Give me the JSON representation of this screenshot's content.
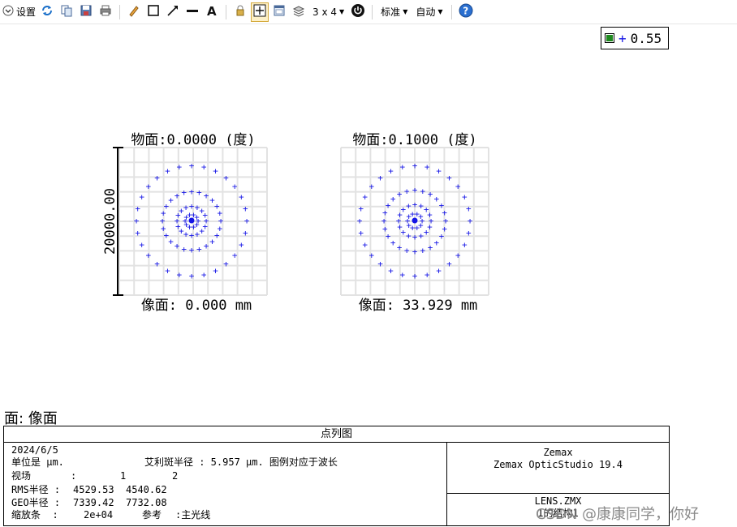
{
  "toolbar": {
    "settings_label": "设置",
    "layout_label": "3 x 4",
    "standard_label": "标准",
    "auto_label": "自动"
  },
  "legend": {
    "value": "0.55",
    "marker": "+"
  },
  "colors": {
    "spot": "#1515e6",
    "grid": "#e2e2e2",
    "scale": "#000000"
  },
  "plots": [
    {
      "title": "物面:0.0000 (度)",
      "image_label": "像面: 0.000 mm"
    },
    {
      "title": "物面:0.1000 (度)",
      "image_label": "像面: 33.929 mm"
    }
  ],
  "scale_bar": {
    "value": "20000.00"
  },
  "plane_label": "面: 像面",
  "footer": {
    "title": "点列图",
    "date": "2024/6/5",
    "units": "单位是 µm.",
    "airy": "艾利斑半径 : 5.957 µm. 图例对应于波长",
    "field_label": "视场",
    "field_sep": ":",
    "field_values": [
      "1",
      "2"
    ],
    "rms_label": "RMS半径 :",
    "rms_values": [
      "4529.53",
      "4540.62"
    ],
    "geo_label": "GEO半径 :",
    "geo_values": [
      "7339.42",
      "7732.08"
    ],
    "scale_label": "缩放条  :",
    "scale_value": "2e+04",
    "ref_label": "参考",
    "ref_value": ":主光线",
    "company": "Zemax",
    "product": "Zemax OpticStudio 19.4",
    "file": "LENS.ZMX",
    "config": "1的结构1"
  },
  "watermark": "CSDN @康康同学，你好"
}
